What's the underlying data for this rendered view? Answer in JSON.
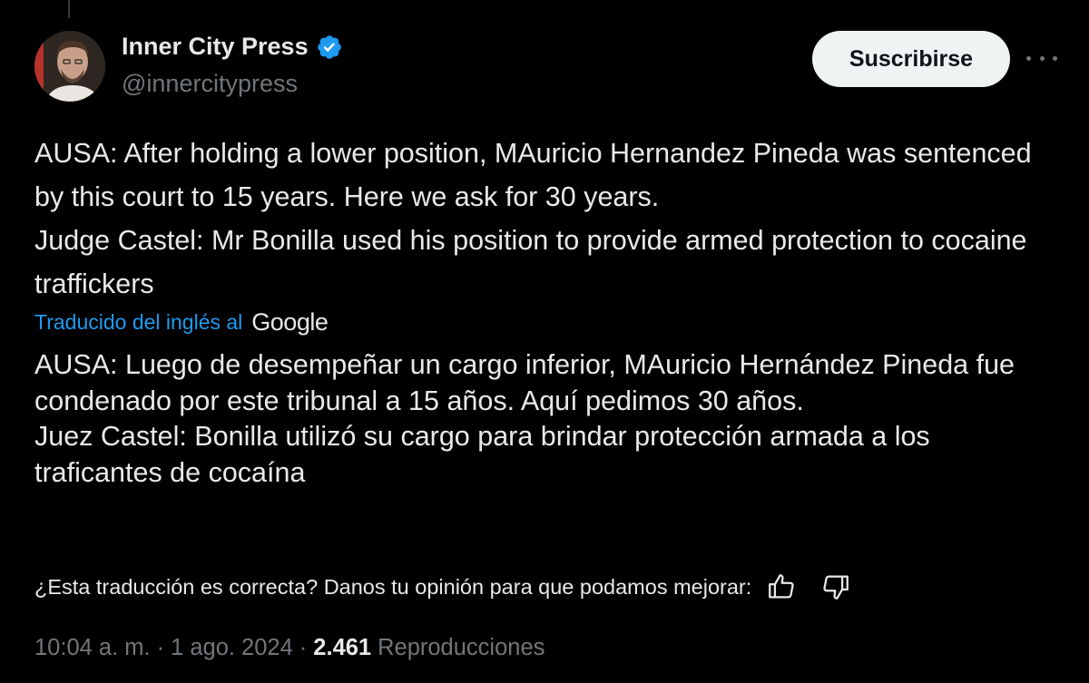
{
  "author": {
    "name": "Inner City Press",
    "handle": "@innercitypress",
    "verified_icon": "verified-badge-icon",
    "verified_color": "#1d9bf0"
  },
  "actions": {
    "subscribe_label": "Suscribirse",
    "more_icon": "more-options-icon"
  },
  "tweet": {
    "text": "AUSA: After holding a lower position, MAuricio Hernandez Pineda was sentenced by this court to 15 years. Here we ask for 30 years.\nJudge Castel: Mr Bonilla used his position to provide armed protection to cocaine traffickers"
  },
  "translation": {
    "label": "Traducido del inglés al",
    "provider": "Google",
    "text": "AUSA: Luego de desempeñar un cargo inferior, MAuricio Hernández Pineda fue condenado por este tribunal a 15 años. Aquí pedimos 30 años.\nJuez Castel: Bonilla utilizó su cargo para brindar protección armada a los traficantes de cocaína",
    "feedback_prompt": "¿Esta traducción es correcta? Danos tu opinión para que podamos mejorar:"
  },
  "meta": {
    "time": "10:04 a. m.",
    "separator": "·",
    "date": "1 ago. 2024",
    "views_count": "2.461",
    "views_label": "Reproducciones"
  },
  "colors": {
    "background": "#000000",
    "text": "#e7e9ea",
    "muted": "#71767b",
    "link": "#1d9bf0"
  }
}
